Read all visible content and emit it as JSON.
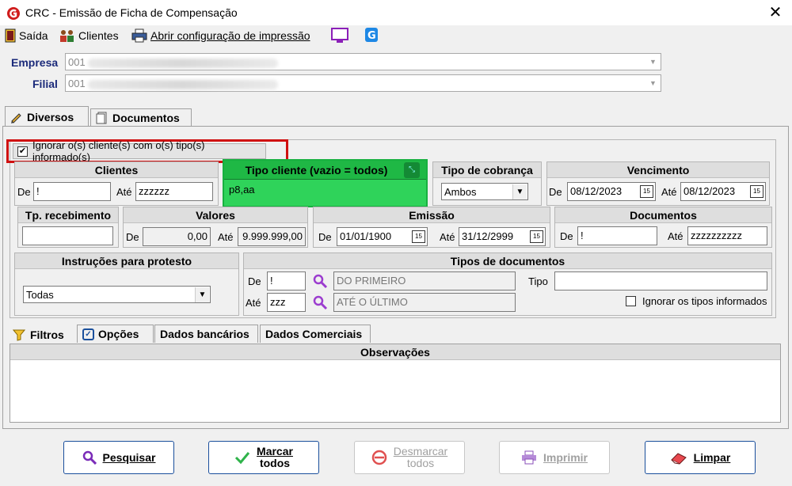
{
  "window": {
    "title": "CRC - Emissão de Ficha de Compensação"
  },
  "menu": {
    "exit": "Saída",
    "clients": "Clientes",
    "print_config": "Abrir configuração de impressão"
  },
  "company": {
    "label": "Empresa",
    "code": "001",
    "branch_label": "Filial",
    "branch_code": "001"
  },
  "tabs": {
    "diversos": "Diversos",
    "documentos": "Documentos"
  },
  "ignore_clients": {
    "label": "Ignorar o(s) cliente(s) com o(s) tipo(s) informado(s)",
    "checked": true
  },
  "clientes": {
    "title": "Clientes",
    "de_label": "De",
    "de_value": "!",
    "ate_label": "Até",
    "ate_value": "zzzzzz"
  },
  "tipo_cliente": {
    "title": "Tipo cliente (vazio = todos)",
    "value": "p8,aa"
  },
  "tipo_cobranca": {
    "title": "Tipo de cobrança",
    "selected": "Ambos"
  },
  "vencimento": {
    "title": "Vencimento",
    "de_label": "De",
    "de_value": "08/12/2023",
    "ate_label": "Até",
    "ate_value": "08/12/2023"
  },
  "tp_recebimento": {
    "title": "Tp. recebimento",
    "value": ""
  },
  "valores": {
    "title": "Valores",
    "de_label": "De",
    "de_value": "0,00",
    "ate_label": "Até",
    "ate_value": "9.999.999,00"
  },
  "emissao": {
    "title": "Emissão",
    "de_label": "De",
    "de_value": "01/01/1900",
    "ate_label": "Até",
    "ate_value": "31/12/2999"
  },
  "documentos_group": {
    "title": "Documentos",
    "de_label": "De",
    "de_value": "!",
    "ate_label": "Até",
    "ate_value": "zzzzzzzzzz"
  },
  "instrucoes": {
    "title": "Instruções para protesto",
    "selected": "Todas"
  },
  "tipos_documentos": {
    "title": "Tipos de documentos",
    "de_label": "De",
    "de_value": "!",
    "de_desc": "DO PRIMEIRO",
    "ate_label": "Até",
    "ate_value": "zzz",
    "ate_desc": "ATÉ O ÚLTIMO",
    "tipo_label": "Tipo",
    "tipo_value": "",
    "ignore_label": "Ignorar os tipos informados",
    "ignore_checked": false
  },
  "bottom_tabs": {
    "filtros": "Filtros",
    "opcoes": "Opções",
    "dados_bancarios": "Dados bancários",
    "dados_comerciais": "Dados Comerciais"
  },
  "observacoes": {
    "title": "Observações",
    "value": ""
  },
  "buttons": {
    "pesquisar": "Pesquisar",
    "marcar_1": "Marcar",
    "marcar_2": "todos",
    "desmarcar_1": "Desmarcar",
    "desmarcar_2": "todos",
    "imprimir": "Imprimir",
    "limpar": "Limpar"
  },
  "colors": {
    "highlight_green": "#2fd35a",
    "highlight_red": "#d01010",
    "accent_blue": "#1b2a7a"
  }
}
